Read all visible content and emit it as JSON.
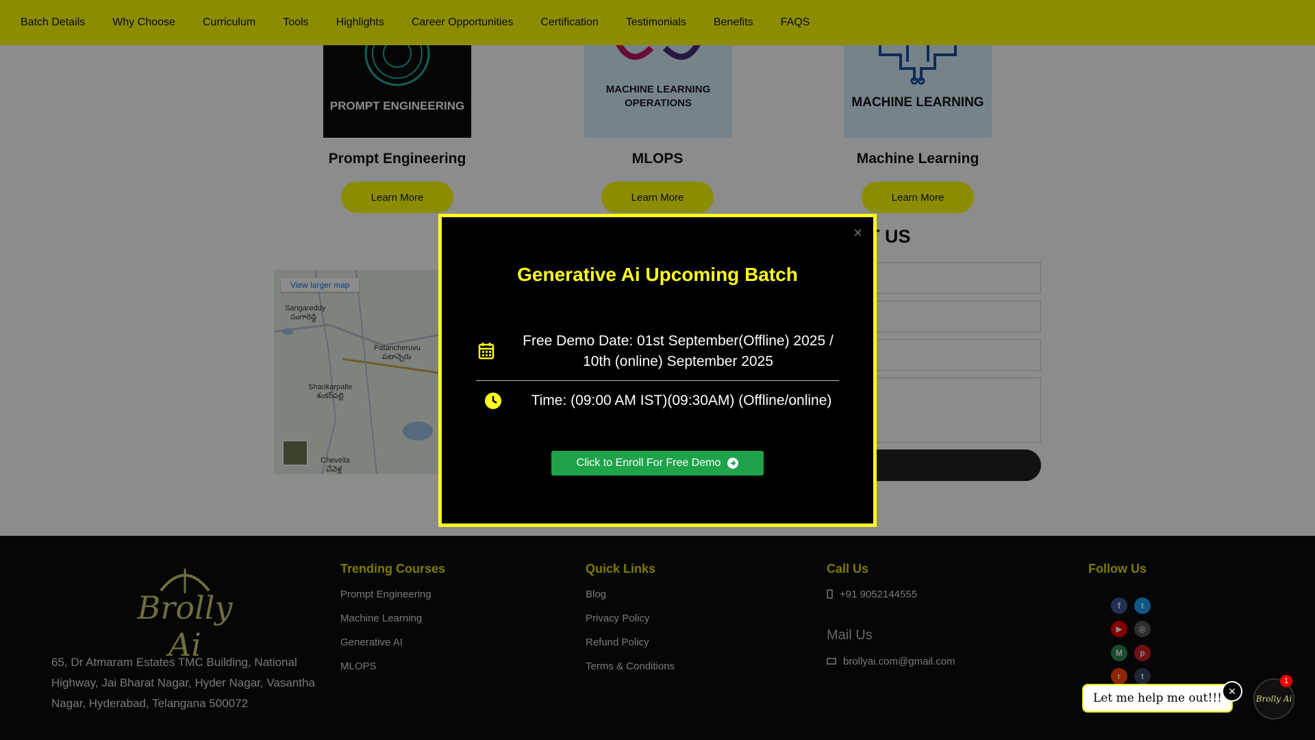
{
  "nav": {
    "items": [
      "Batch Details",
      "Why Choose",
      "Curriculum",
      "Tools",
      "Highlights",
      "Career Opportunities",
      "Certification",
      "Testimonials",
      "Benefits",
      "FAQS"
    ]
  },
  "courses": [
    {
      "card_text": "PROMPT ENGINEERING",
      "title": "Prompt Engineering",
      "button": "Learn More"
    },
    {
      "card_text": "MACHINE LEARNING OPERATIONS",
      "title": "MLOPS",
      "button": "Learn More"
    },
    {
      "card_text": "MACHINE LEARNING",
      "title": "Machine Learning",
      "button": "Learn More"
    }
  ],
  "map": {
    "larger_link": "View larger map",
    "places": [
      "Sangareddy",
      "సంగారెడ్డి",
      "Patancheruvu",
      "పటాన్చెరు",
      "Shankarpalle",
      "శంకర్‌పల్లి",
      "Chevella",
      "చేవెళ్ల"
    ]
  },
  "contact": {
    "heading_visible": "T US"
  },
  "modal": {
    "close": "×",
    "title": "Generative Ai Upcoming Batch",
    "demo_date": "Free Demo Date: 01st September(Offline) 2025 / 10th (online) September 2025",
    "time": "Time: (09:00 AM IST)(09:30AM) (Offline/online)",
    "enroll_button": "Click to Enroll For Free Demo"
  },
  "footer": {
    "logo_text": "Brolly Ai",
    "address": "65, Dr Atmaram Estates TMC Building, National Highway, Jai Bharat Nagar, Hyder Nagar, Vasantha Nagar, Hyderabad, Telangana 500072",
    "trending": {
      "heading": "Trending Courses",
      "items": [
        "Prompt Engineering",
        "Machine Learning",
        "Generative AI",
        "MLOPS"
      ]
    },
    "quick_links": {
      "heading": "Quick Links",
      "items": [
        "Blog",
        "Privacy Policy",
        "Refund Policy",
        "Terms & Conditions"
      ]
    },
    "call": {
      "heading": "Call Us",
      "phone": "+91 9052144555"
    },
    "mail": {
      "heading": "Mail Us",
      "email": "brollyai.com@gmail.com"
    },
    "follow": {
      "heading": "Follow Us"
    }
  },
  "chat": {
    "prompt": "Let me help me out!!!",
    "badge": "1",
    "avatar_text": "Brolly Ai"
  },
  "colors": {
    "accent_yellow": "#ffff00",
    "enroll_green": "#1ea34a",
    "footer_bg": "#0c0c0c"
  }
}
